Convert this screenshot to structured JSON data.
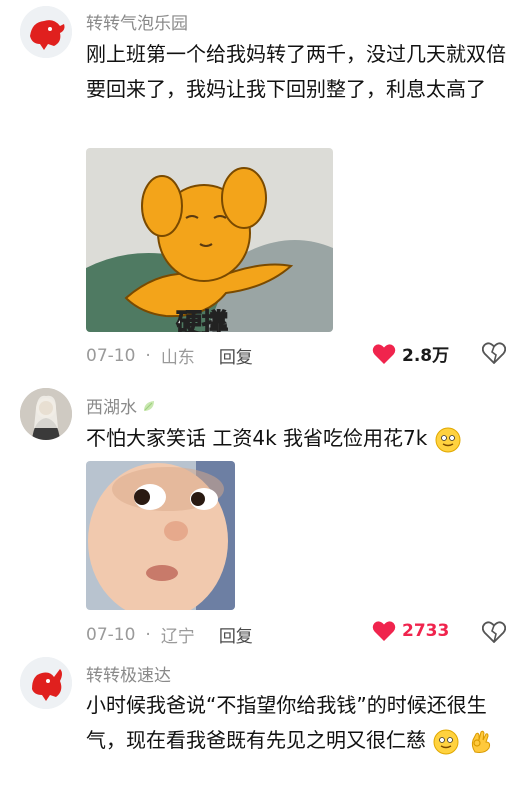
{
  "comments": [
    {
      "username": "转转气泡乐园",
      "text": "刚上班第一个给我妈转了两千，没过几天就双倍要回来了，我妈让我下回别整了，利息太高了",
      "image_caption": "硬撑",
      "date": "07-10",
      "location": "山东",
      "reply_label": "回复",
      "likes": "2.8万"
    },
    {
      "username": "西湖水",
      "text": "不怕大家笑话 工资4k 我省吃俭用花7k",
      "date": "07-10",
      "location": "辽宁",
      "reply_label": "回复",
      "likes": "2733"
    },
    {
      "username": "转转极速达",
      "text": "小时候我爸说“不指望你给我钱”的时候还很生气，现在看我爸既有先见之明又很仁慈"
    }
  ],
  "colors": {
    "like_red": "#f0244d",
    "username_gray": "#8a8a8a"
  }
}
